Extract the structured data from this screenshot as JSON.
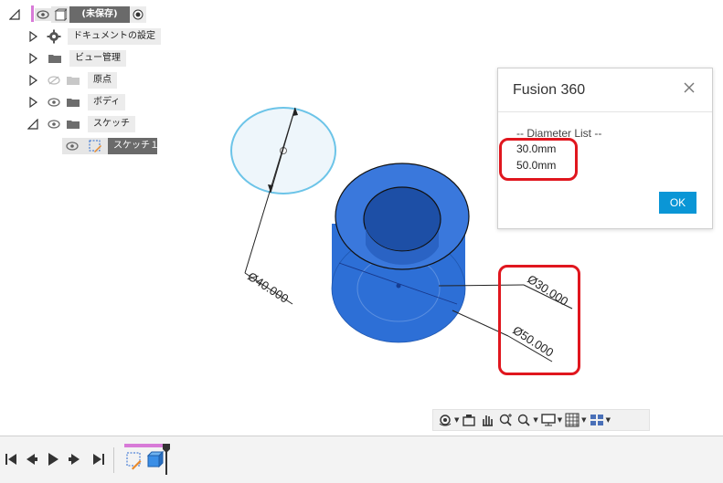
{
  "browser": {
    "root_label": "(未保存)",
    "items": [
      {
        "label": "ドキュメントの設定"
      },
      {
        "label": "ビュー管理"
      },
      {
        "label": "原点"
      },
      {
        "label": "ボディ"
      },
      {
        "label": "スケッチ"
      }
    ],
    "sketch_child_label": "スケッチ１"
  },
  "viewport": {
    "dim_top_circle": "Ø40.000",
    "dim_inner": "Ø30.000",
    "dim_outer": "Ø50.000"
  },
  "dialog": {
    "title": "Fusion 360",
    "heading": "-- Diameter List --",
    "line1": "30.0mm",
    "line2": "50.0mm",
    "ok_label": "OK"
  },
  "colors": {
    "accent": "#0a96d6",
    "annotation_red": "#e0161e",
    "body_blue": "#2d6fd6",
    "sketch_circle": "#6cc4e8",
    "root_marker": "#d87ad8"
  },
  "navbar": {
    "icons": [
      "orbit-icon",
      "look-at-icon",
      "pan-icon",
      "zoom-window-icon",
      "zoom-icon",
      "display-settings-icon",
      "grid-icon",
      "viewports-icon"
    ]
  },
  "timeline": {
    "controls": [
      "go-to-start-icon",
      "step-back-icon",
      "play-icon",
      "step-forward-icon",
      "go-to-end-icon"
    ]
  }
}
